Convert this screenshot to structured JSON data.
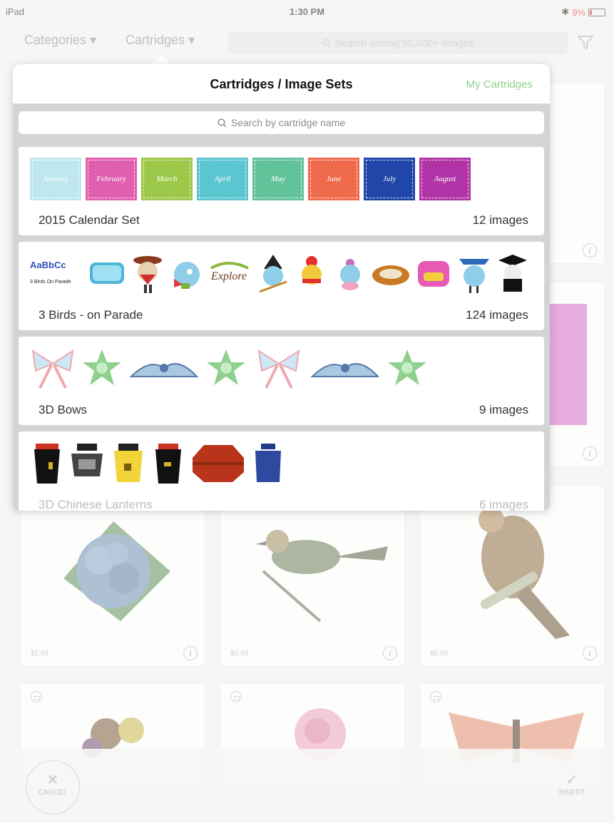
{
  "status_bar": {
    "carrier": "iPad",
    "time": "1:30 PM",
    "battery": "9%"
  },
  "nav": {
    "categories_label": "Categories ▾",
    "cartridges_label": "Cartridges ▾",
    "search_placeholder": "Search among 50,000+ images"
  },
  "popover": {
    "title": "Cartridges / Image Sets",
    "my_cartridges": "My Cartridges",
    "search_placeholder": "Search by cartridge name",
    "cartridges": [
      {
        "name": "2015 Calendar Set",
        "count": "12 images",
        "months": [
          "January",
          "February",
          "March",
          "April",
          "May",
          "June",
          "July",
          "August"
        ],
        "month_colors": [
          "#bfe8ee",
          "#e05fae",
          "#9cc94a",
          "#5cc6d0",
          "#62c39b",
          "#ef6a4b",
          "#1f46a8",
          "#b034a6"
        ]
      },
      {
        "name": "3 Birds - on Parade",
        "count": "124 images",
        "first_thumb_title": "AaBbCc",
        "first_thumb_sub": "3 Birds On Parade"
      },
      {
        "name": "3D Bows",
        "count": "9 images"
      },
      {
        "name": "3D Chinese Lanterns",
        "count": "6 images"
      }
    ]
  },
  "grid": {
    "prices": [
      "$1.99",
      "$0.99",
      "$0.99"
    ]
  },
  "bottom": {
    "cancel_label": "CANCEL",
    "insert_label": "INSERT"
  },
  "colors": {
    "accent_green": "#8fd18b"
  }
}
